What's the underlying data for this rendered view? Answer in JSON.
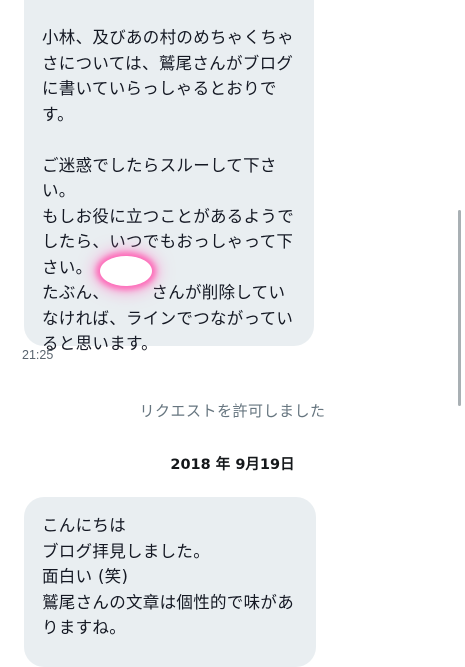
{
  "messages": [
    {
      "text": "小林、及びあの村のめちゃくちゃさについては、鷲尾さんがブログに書いていらっしゃるとおりです。\n\nご迷惑でしたらスルーして下さい。\nもしお役に立つことがあるようでしたら、いつでもおっしゃって下さい。\nたぶん、　　　さんが削除していなければ、ラインでつながっていると思います。",
      "time": "21:25"
    },
    {
      "text": "こんにちは\nブログ拝見しました。\n面白い (笑)\n鷲尾さんの文章は個性的で味がありますね。"
    }
  ],
  "system_note": "リクエストを許可しました",
  "date_divider": "2018 年 9月19日",
  "colors": {
    "bubble": "#e9eef1",
    "redaction_glow": "#ff5cb2"
  }
}
